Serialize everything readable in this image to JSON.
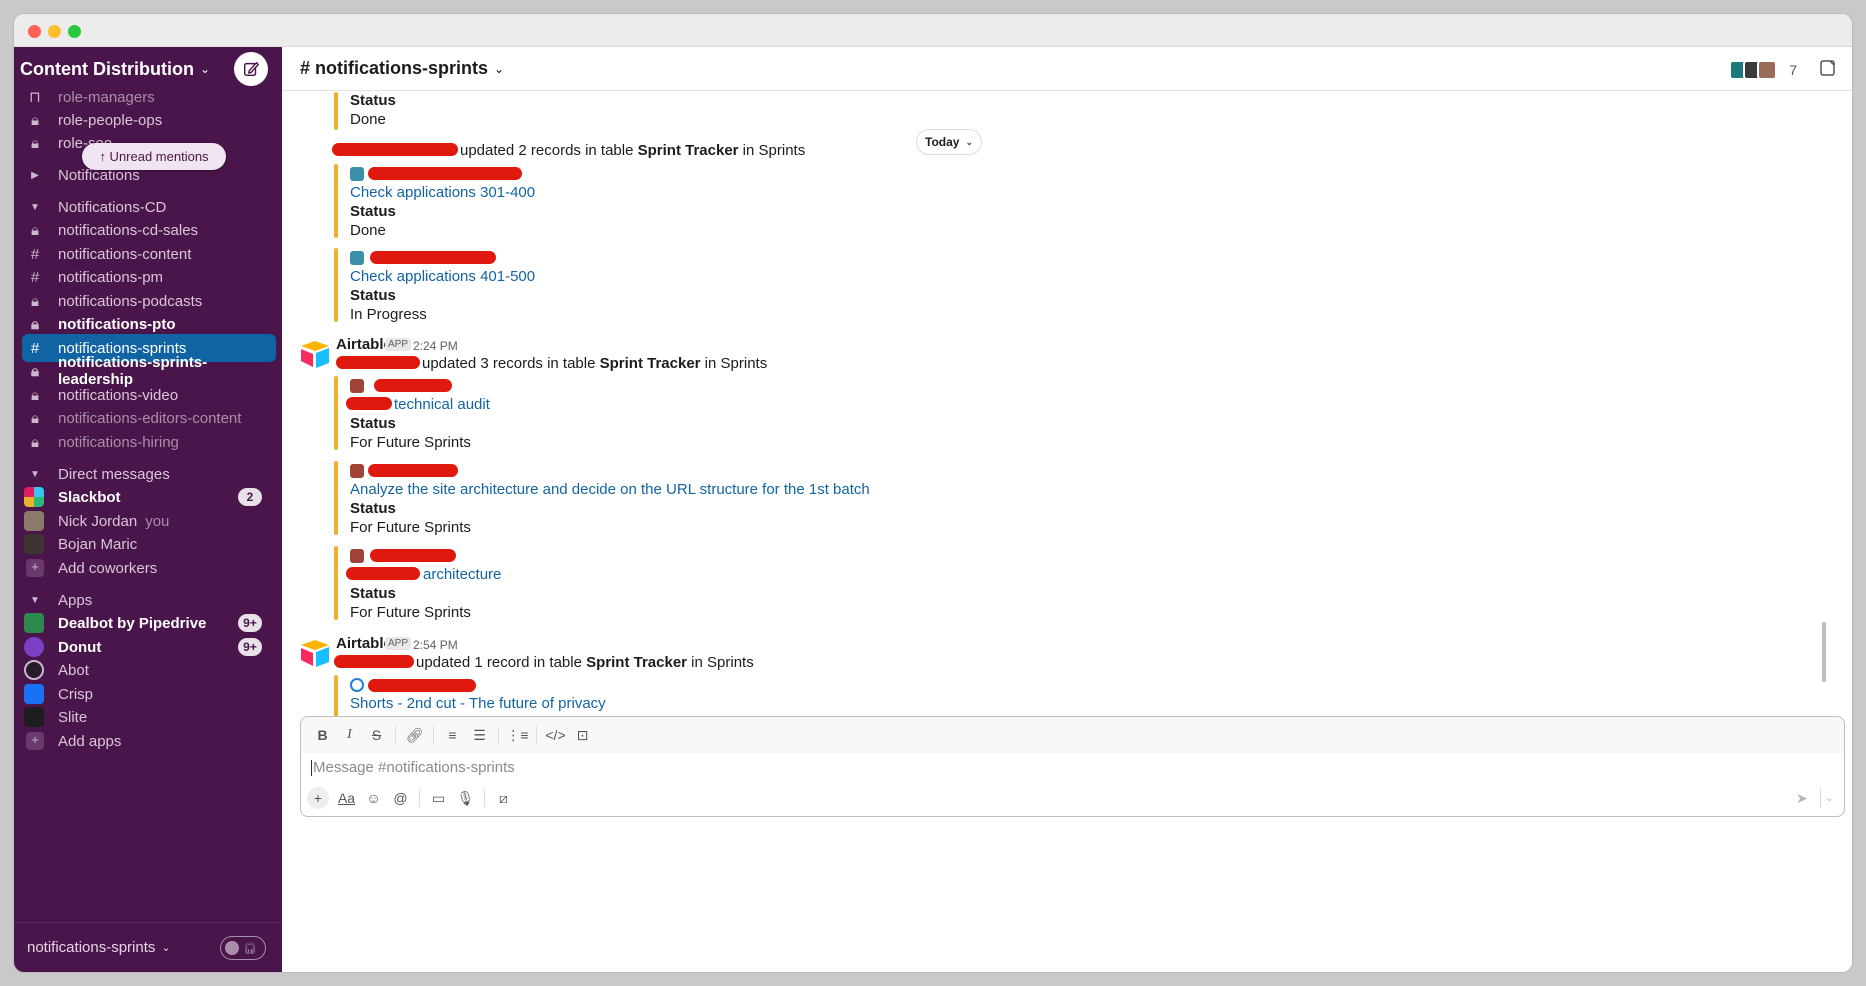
{
  "workspace": {
    "name": "Content Distribution"
  },
  "sidebar": {
    "unread_pill": "↑ Unread mentions",
    "items": [
      {
        "label": "role-managers",
        "icon": "lock-icon",
        "style": "dim"
      },
      {
        "label": "role-people-ops",
        "icon": "lock-icon",
        "style": "normal"
      },
      {
        "label": "role-seo",
        "icon": "lock-icon",
        "style": "normal"
      },
      {
        "label": "Notifications",
        "icon": "caret-right-icon",
        "style": "section"
      },
      {
        "label": "Notifications-CD",
        "icon": "caret-down-icon",
        "style": "section"
      },
      {
        "label": "notifications-cd-sales",
        "icon": "lock-icon",
        "style": "normal"
      },
      {
        "label": "notifications-content",
        "icon": "hash-icon",
        "style": "normal"
      },
      {
        "label": "notifications-pm",
        "icon": "hash-icon",
        "style": "normal"
      },
      {
        "label": "notifications-podcasts",
        "icon": "lock-icon",
        "style": "normal"
      },
      {
        "label": "notifications-pto",
        "icon": "lock-icon",
        "style": "bold"
      },
      {
        "label": "notifications-sprints",
        "icon": "hash-icon",
        "style": "active"
      },
      {
        "label": "notifications-sprints-leadership",
        "icon": "lock-icon",
        "style": "bold"
      },
      {
        "label": "notifications-video",
        "icon": "lock-icon",
        "style": "normal"
      },
      {
        "label": "notifications-editors-content",
        "icon": "lock-icon",
        "style": "dim"
      },
      {
        "label": "notifications-hiring",
        "icon": "lock-icon",
        "style": "dim"
      },
      {
        "label": "Direct messages",
        "icon": "caret-down-icon",
        "style": "section"
      },
      {
        "label": "Slackbot",
        "icon": "slackbot-avatar",
        "style": "bold",
        "badge": "2"
      },
      {
        "label": "Nick Jordan",
        "icon": "user-avatar",
        "style": "normal",
        "suffix": "you"
      },
      {
        "label": "Bojan Maric",
        "icon": "user-avatar",
        "style": "normal"
      },
      {
        "label": "Add coworkers",
        "icon": "plus-icon",
        "style": "normal"
      },
      {
        "label": "Apps",
        "icon": "caret-down-icon",
        "style": "section"
      },
      {
        "label": "Dealbot by Pipedrive",
        "icon": "dealbot-icon",
        "style": "bold",
        "badge": "9+"
      },
      {
        "label": "Donut",
        "icon": "donut-icon",
        "style": "bold",
        "badge": "9+"
      },
      {
        "label": "Abot",
        "icon": "abot-icon",
        "style": "normal"
      },
      {
        "label": "Crisp",
        "icon": "crisp-icon",
        "style": "normal"
      },
      {
        "label": "Slite",
        "icon": "slite-icon",
        "style": "normal"
      },
      {
        "label": "Add apps",
        "icon": "plus-icon",
        "style": "normal"
      }
    ],
    "footer": {
      "label": "notifications-sprints"
    }
  },
  "channel": {
    "title": "# notifications-sprints",
    "member_count": "7"
  },
  "today_pill": "Today",
  "messages": {
    "status_label": "Status",
    "top_fragment_value": "Done",
    "m1": {
      "summary_pre": "updated 2 records in table ",
      "table": "Sprint Tracker",
      "summary_post": " in Sprints",
      "records": [
        {
          "title": "Check applications 301-400",
          "status": "Done"
        },
        {
          "title": "Check applications 401-500",
          "status": "In Progress"
        }
      ]
    },
    "m2": {
      "app": "Airtable",
      "tag": "APP",
      "time": "2:24 PM",
      "summary_pre": "updated 3 records in table ",
      "table": "Sprint Tracker",
      "summary_post": " in Sprints",
      "records": [
        {
          "title": "technical audit",
          "status": "For Future Sprints"
        },
        {
          "title": "Analyze the site architecture and decide on the URL structure for the 1st batch",
          "status": "For Future Sprints"
        },
        {
          "title": "architecture",
          "status": "For Future Sprints"
        }
      ]
    },
    "m3": {
      "app": "Airtable",
      "tag": "APP",
      "time": "2:54 PM",
      "summary_pre": "updated 1 record in table ",
      "table": "Sprint Tracker",
      "summary_post": " in Sprints",
      "records": [
        {
          "title": "Shorts - 2nd cut - The future of privacy"
        }
      ]
    }
  },
  "composer": {
    "placeholder": "Message #notifications-sprints"
  },
  "colors": {
    "sidebar_bg": "#4a154b",
    "active_bg": "#1164a3",
    "attachment_bar": "#ecb22e",
    "link": "#1264a3",
    "redaction": "#e0190f"
  }
}
